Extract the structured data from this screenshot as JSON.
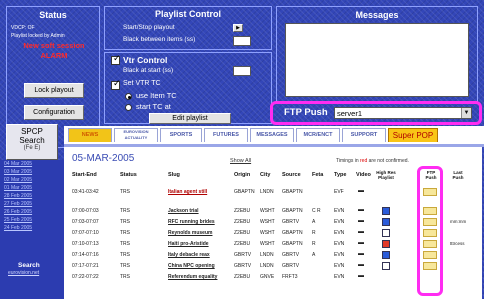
{
  "status": {
    "title": "Status",
    "user_line": "VDCP: OF",
    "locked_line": "Playlist locked by Admin",
    "alarm_line1": "New soft session",
    "alarm_line2": "ALARM",
    "lock_button": "Lock playout",
    "config_button": "Configuration"
  },
  "playlist": {
    "title": "Playlist Control",
    "start_stop": "Start/Stop playout",
    "black_between": "Black between items (ss)",
    "edit_button": "Edit playlist"
  },
  "vtr": {
    "title": "Vtr Control",
    "black_at_start": "Black at start (ss)",
    "set_vtr_tc": "Set VTR TC",
    "use_item_tc": "use Item TC",
    "start_tc_at": "start TC at"
  },
  "messages": {
    "title": "Messages"
  },
  "ftp": {
    "label": "FTP Push",
    "selected": "server1"
  },
  "spcp": {
    "line1": "SPCP",
    "line2": "Search",
    "line3": "(Fe E)"
  },
  "sidebar": {
    "dates": [
      "04 Mar 2005",
      "03 Mar 2005",
      "02 Mar 2005",
      "01 Mar 2005",
      "28 Feb 2005",
      "27 Feb 2005",
      "26 Feb 2005",
      "25 Feb 2005",
      "24 Feb 2005"
    ],
    "search_label": "Search",
    "search_sub": "eurovision.net"
  },
  "tabs": [
    "NEWS",
    "EUROVISION ACTUALITY",
    "SPORTS",
    "FUTURES",
    "MESSAGES",
    "MCR/ENCT",
    "SUPPORT",
    "Super POP"
  ],
  "page": {
    "date": "05-MAR-2005",
    "show_all": "Show All",
    "timings_a": "Timings in",
    "timings_red": "red",
    "timings_b": "are not confirmed."
  },
  "columns": [
    "Start-End",
    "Status",
    "Slug",
    "Origin",
    "City",
    "Source",
    "Feta",
    "Type",
    "Video",
    "High Res Playlist",
    "FTP Push",
    "Last Push"
  ],
  "rows": [
    {
      "time": "03:41-03:42",
      "status": "TRS",
      "slug": "Italian agent still",
      "origin": "GBAPTN",
      "city": "LNDN",
      "source": "GBAPTN",
      "feta": "",
      "type": "EVF",
      "redslug": true
    },
    {
      "time": "07:00-07:03",
      "status": "TRS",
      "slug": "Jackson trial",
      "origin": "Z2EBU",
      "city": "WSHT",
      "source": "GBAPTN",
      "feta": "C R",
      "type": "EVN",
      "redslug": false
    },
    {
      "time": "07:03-07:07",
      "status": "TRS",
      "slug": "RFC running brides",
      "origin": "Z2EBU",
      "city": "WSHT",
      "source": "GBRTV",
      "feta": "A",
      "type": "EVN",
      "redslug": false
    },
    {
      "time": "07:07-07:10",
      "status": "TRS",
      "slug": "Reynolds museum",
      "origin": "Z2EBU",
      "city": "WSHT",
      "source": "GBAPTN",
      "feta": "R",
      "type": "EVN",
      "redslug": false
    },
    {
      "time": "07:10-07:13",
      "status": "TRS",
      "slug": "Haiti pro-Aristide",
      "origin": "Z2EBU",
      "city": "WSHT",
      "source": "GBAPTN",
      "feta": "R",
      "type": "EVN",
      "redslug": false
    },
    {
      "time": "07:14-07:16",
      "status": "TRS",
      "slug": "Italy debacle reax",
      "origin": "GBRTV",
      "city": "LNDN",
      "source": "GBRTV",
      "feta": "A",
      "type": "EVN",
      "redslug": false
    },
    {
      "time": "07:17-07:21",
      "status": "TRS",
      "slug": "China NPC opening",
      "origin": "GBRTV",
      "city": "LNDN",
      "source": "GBRTV",
      "feta": "",
      "type": "EVN",
      "redslug": false
    },
    {
      "time": "07:22-07:22",
      "status": "TRS",
      "slug": "Referendum equality",
      "origin": "Z2EBU",
      "city": "GNVE",
      "source": "FRFT3",
      "feta": "",
      "type": "EVN",
      "redslug": false
    }
  ],
  "last_push": [
    "",
    "",
    "mm:mm",
    "",
    "tttrcess",
    "",
    "",
    ""
  ]
}
